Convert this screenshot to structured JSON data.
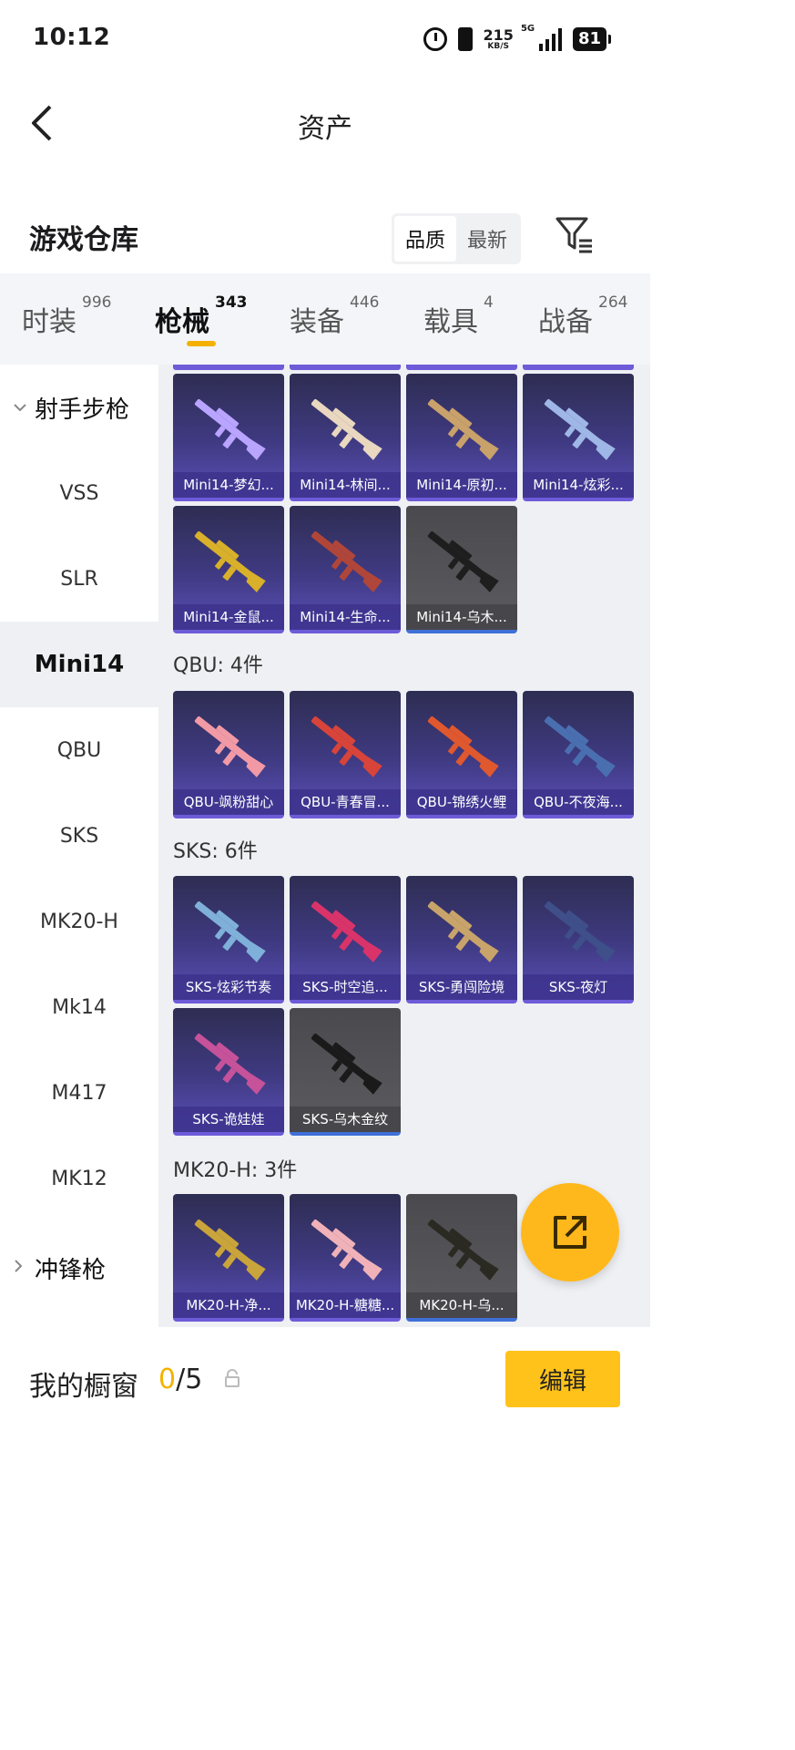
{
  "status": {
    "time": "10:12",
    "speed_value": "215",
    "speed_unit": "KB/S",
    "network": "5G",
    "battery": "81"
  },
  "nav": {
    "title": "资产"
  },
  "section": {
    "title": "游戏仓库",
    "sort_options": [
      "品质",
      "最新"
    ]
  },
  "tabs": [
    {
      "label": "时装",
      "count": "996"
    },
    {
      "label": "枪械",
      "count": "343"
    },
    {
      "label": "装备",
      "count": "446"
    },
    {
      "label": "载具",
      "count": "4"
    },
    {
      "label": "战备",
      "count": "264"
    }
  ],
  "sidebar": {
    "category_open": "射手步枪",
    "items": [
      "VSS",
      "SLR",
      "Mini14",
      "QBU",
      "SKS",
      "MK20-H",
      "Mk14",
      "M417",
      "MK12"
    ],
    "selected": "Mini14",
    "category_closed": "冲锋枪"
  },
  "groups": [
    {
      "title": "",
      "items": [
        {
          "label": "Mini14-梦幻...",
          "style": "purple",
          "gun": "#b9a4ff"
        },
        {
          "label": "Mini14-林间...",
          "style": "purple",
          "gun": "#e9d7c0"
        },
        {
          "label": "Mini14-原初...",
          "style": "purple",
          "gun": "#c9a16a"
        },
        {
          "label": "Mini14-炫彩...",
          "style": "purple",
          "gun": "#9fb7e6"
        },
        {
          "label": "Mini14-金鼠...",
          "style": "purple",
          "gun": "#d8b02a"
        },
        {
          "label": "Mini14-生命...",
          "style": "purple",
          "gun": "#b0463a"
        },
        {
          "label": "Mini14-乌木...",
          "style": "grey",
          "gun": "#1e1e1e"
        }
      ]
    },
    {
      "title": "QBU: 4件",
      "items": [
        {
          "label": "QBU-飒粉甜心",
          "style": "purple",
          "gun": "#f19aa6"
        },
        {
          "label": "QBU-青春冒...",
          "style": "purple",
          "gun": "#d8443a"
        },
        {
          "label": "QBU-锦绣火鲤",
          "style": "purple",
          "gun": "#e0582e"
        },
        {
          "label": "QBU-不夜海...",
          "style": "purple",
          "gun": "#4a6fb0"
        }
      ]
    },
    {
      "title": "SKS: 6件",
      "items": [
        {
          "label": "SKS-炫彩节奏",
          "style": "purple",
          "gun": "#7fb0d9"
        },
        {
          "label": "SKS-时空追...",
          "style": "purple",
          "gun": "#d9336a"
        },
        {
          "label": "SKS-勇闯险境",
          "style": "purple",
          "gun": "#c9a46a"
        },
        {
          "label": "SKS-夜灯",
          "style": "purple",
          "gun": "#3e4f8a"
        },
        {
          "label": "SKS-诡娃娃",
          "style": "purple",
          "gun": "#c6529a"
        },
        {
          "label": "SKS-乌木金纹",
          "style": "grey",
          "gun": "#1a1a1a"
        }
      ]
    },
    {
      "title": "MK20-H: 3件",
      "items": [
        {
          "label": "MK20-H-净...",
          "style": "purple",
          "gun": "#c9a43a"
        },
        {
          "label": "MK20-H-糖糖...",
          "style": "purple",
          "gun": "#f0b2b8"
        },
        {
          "label": "MK20-H-乌...",
          "style": "grey",
          "gun": "#2a2a22"
        }
      ]
    }
  ],
  "bottom": {
    "label": "我的橱窗",
    "current": "0",
    "sep_total": "/5",
    "edit": "编辑"
  },
  "colors": {
    "accent": "#f5b100",
    "button": "#ffc21a",
    "card_purple": "#3f3a82",
    "card_grey": "#5c5c60"
  }
}
